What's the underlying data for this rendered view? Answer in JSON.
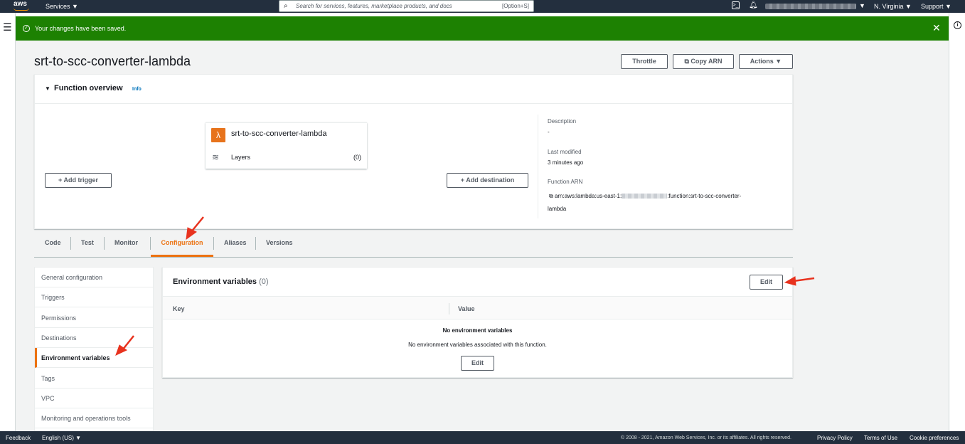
{
  "topnav": {
    "logo": "aws",
    "services": "Services ▼",
    "search_placeholder": "Search for services, features, marketplace products, and docs",
    "search_shortcut": "[Option+S]",
    "region": "N. Virginia ▼",
    "support": "Support ▼",
    "account_caret": "▼"
  },
  "flash": {
    "message": "Your changes have been saved.",
    "close": "✕",
    "color": "#1d8102"
  },
  "page": {
    "title": "srt-to-scc-converter-lambda",
    "throttle": "Throttle",
    "copy_arn": "Copy ARN",
    "actions": "Actions ▼"
  },
  "overview": {
    "toggle": "▼",
    "title": "Function overview",
    "info": "Info",
    "function_name": "srt-to-scc-converter-lambda",
    "layers_label": "Layers",
    "layers_count": "(0)",
    "add_trigger": "Add trigger",
    "add_destination": "Add destination",
    "description_label": "Description",
    "description_value": "-",
    "last_modified_label": "Last modified",
    "last_modified_value": "3 minutes ago",
    "arn_label": "Function ARN",
    "arn_prefix": "arn:aws:lambda:us-east-1:",
    "arn_suffix": ":function:srt-to-scc-converter-",
    "arn_wrap": "lambda"
  },
  "tabs": [
    {
      "label": "Code"
    },
    {
      "label": "Test"
    },
    {
      "label": "Monitor"
    },
    {
      "label": "Configuration"
    },
    {
      "label": "Aliases"
    },
    {
      "label": "Versions"
    }
  ],
  "sidemenu": [
    {
      "label": "General configuration"
    },
    {
      "label": "Triggers"
    },
    {
      "label": "Permissions"
    },
    {
      "label": "Destinations"
    },
    {
      "label": "Environment variables"
    },
    {
      "label": "Tags"
    },
    {
      "label": "VPC"
    },
    {
      "label": "Monitoring and operations tools"
    }
  ],
  "env": {
    "title": "Environment variables",
    "count": "(0)",
    "edit": "Edit",
    "col_key": "Key",
    "col_value": "Value",
    "empty_title": "No environment variables",
    "empty_desc": "No environment variables associated with this function.",
    "empty_edit": "Edit"
  },
  "footer": {
    "feedback": "Feedback",
    "language": "English (US) ▼",
    "copyright": "© 2008 - 2021, Amazon Web Services, Inc. or its affiliates. All rights reserved.",
    "privacy": "Privacy Policy",
    "terms": "Terms of Use",
    "cookies": "Cookie preferences"
  },
  "colors": {
    "nav": "#232f3e",
    "accent": "#ec7211",
    "link": "#0073bb",
    "annotation_arrow": "#e8321e"
  }
}
